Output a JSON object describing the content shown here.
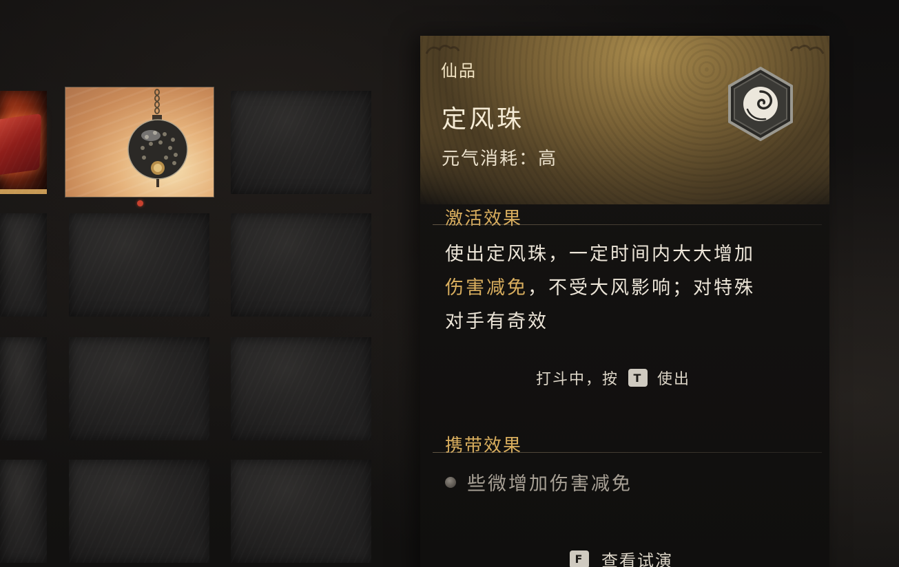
{
  "detail": {
    "rarity": "仙品",
    "name": "定风珠",
    "cost": "元气消耗：高",
    "emblem_icon": "swirl-orb-hexagon-icon",
    "activation_title": "激活效果",
    "activation_text_1": "使出定风珠，一定时间内大大增加",
    "activation_highlight": "伤害减免",
    "activation_text_2": "，不受大风影响；对特殊",
    "activation_text_3": "对手有奇效",
    "use_hint_prefix": "打斗中，按",
    "use_hint_key": "T",
    "use_hint_suffix": "使出",
    "carry_title": "携带效果",
    "carry_effects": [
      "些微增加伤害减免"
    ],
    "preview_key": "F",
    "preview_label": "查看试演"
  },
  "inventory": {
    "selected_item_icon": "wind-pearl-orb-icon",
    "selected_marker_color": "#c8412e"
  },
  "colors": {
    "highlight": "#d9ae5e",
    "text": "#ece5d8"
  }
}
